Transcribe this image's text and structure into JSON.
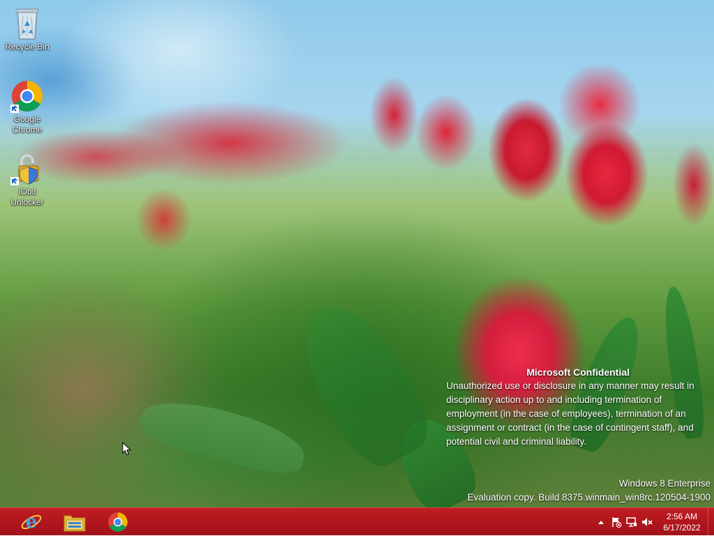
{
  "desktop": {
    "icons": [
      {
        "label": "Recycle Bin",
        "icon": "recycle-bin-icon"
      },
      {
        "label": "Google Chrome",
        "icon": "chrome-icon"
      },
      {
        "label": "IObit Unlocker",
        "icon": "iobit-unlocker-icon"
      }
    ],
    "notice": {
      "title": "Microsoft Confidential",
      "body": "Unauthorized use or disclosure in any manner may result in disciplinary action up to and including termination of employment (in the case of employees), termination of an assignment or contract (in the case of contingent staff), and potential civil and criminal liability."
    },
    "watermark": {
      "edition": "Windows 8 Enterprise",
      "build": "Evaluation copy. Build 8375.winmain_win8rc.120504-1900"
    }
  },
  "taskbar": {
    "color": "#b0161d",
    "pinned": [
      {
        "name": "Internet Explorer",
        "icon": "internet-explorer-icon"
      },
      {
        "name": "File Explorer",
        "icon": "file-explorer-icon"
      },
      {
        "name": "Google Chrome",
        "icon": "chrome-icon"
      }
    ],
    "tray": {
      "icons": [
        "show-hidden-icons-chevron",
        "action-center-flag-icon",
        "network-icon",
        "volume-muted-icon"
      ],
      "time": "2:56 AM",
      "date": "6/17/2022"
    }
  }
}
